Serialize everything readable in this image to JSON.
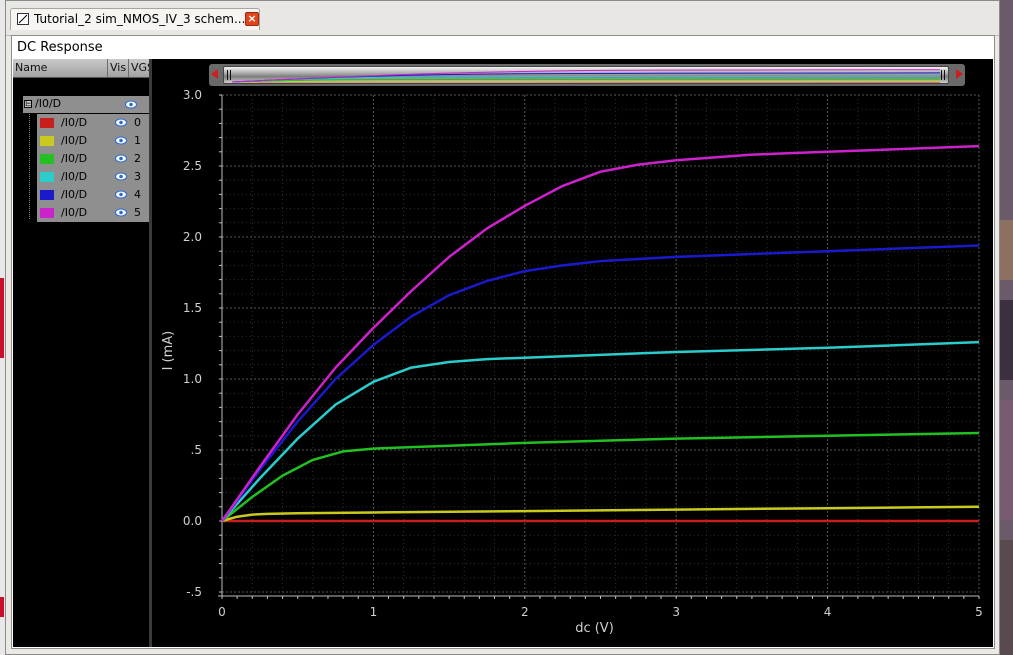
{
  "window": {
    "tab_title": "Tutorial_2 sim_NMOS_IV_3 schem...",
    "tab_close": "×",
    "panel_title": "DC Response"
  },
  "legend": {
    "columns": [
      "Name",
      "Vis",
      "VGS"
    ],
    "root": {
      "label": "/I0/D",
      "toggle": "⊟"
    },
    "rows": [
      {
        "label": "/I0/D",
        "vgs": "0",
        "color": "#c81e1e"
      },
      {
        "label": "/I0/D",
        "vgs": "1",
        "color": "#c9c91e"
      },
      {
        "label": "/I0/D",
        "vgs": "2",
        "color": "#22c022"
      },
      {
        "label": "/I0/D",
        "vgs": "3",
        "color": "#2acccc"
      },
      {
        "label": "/I0/D",
        "vgs": "4",
        "color": "#1a1acc"
      },
      {
        "label": "/I0/D",
        "vgs": "5",
        "color": "#cc22cc"
      }
    ]
  },
  "chart_data": {
    "type": "line",
    "title": "",
    "xlabel": "dc (V)",
    "ylabel": "I (mA)",
    "xlim": [
      0,
      5
    ],
    "ylim": [
      -0.5,
      3.0
    ],
    "x_ticks": [
      "0",
      "1",
      "2",
      "3",
      "4",
      "5"
    ],
    "y_ticks": [
      "-.5",
      "0.0",
      ".5",
      "1.0",
      "1.5",
      "2.0",
      "2.5",
      "3.0"
    ],
    "grid": true,
    "series": [
      {
        "name": "/I0/D",
        "color": "#c81e1e",
        "x": [
          0,
          1,
          2,
          3,
          4,
          5
        ],
        "y": [
          0,
          0,
          0,
          0,
          0,
          0
        ]
      },
      {
        "name": "/I0/D",
        "color": "#c9c91e",
        "x": [
          0,
          0.1,
          0.2,
          0.3,
          0.5,
          1,
          2,
          3,
          4,
          5
        ],
        "y": [
          0,
          0.03,
          0.045,
          0.05,
          0.055,
          0.06,
          0.07,
          0.08,
          0.09,
          0.1
        ]
      },
      {
        "name": "/I0/D",
        "color": "#22c022",
        "x": [
          0,
          0.2,
          0.4,
          0.6,
          0.8,
          1.0,
          1.5,
          2,
          3,
          4,
          5
        ],
        "y": [
          0,
          0.17,
          0.32,
          0.43,
          0.49,
          0.51,
          0.53,
          0.55,
          0.58,
          0.6,
          0.62
        ]
      },
      {
        "name": "/I0/D",
        "color": "#2acccc",
        "x": [
          0,
          0.25,
          0.5,
          0.75,
          1.0,
          1.25,
          1.5,
          1.75,
          2,
          3,
          4,
          5
        ],
        "y": [
          0,
          0.3,
          0.58,
          0.82,
          0.98,
          1.08,
          1.12,
          1.14,
          1.15,
          1.19,
          1.22,
          1.26
        ]
      },
      {
        "name": "/I0/D",
        "color": "#1a1acc",
        "x": [
          0,
          0.25,
          0.5,
          0.75,
          1.0,
          1.25,
          1.5,
          1.75,
          2,
          2.25,
          2.5,
          3,
          4,
          5
        ],
        "y": [
          0,
          0.36,
          0.7,
          1.0,
          1.24,
          1.44,
          1.59,
          1.69,
          1.76,
          1.8,
          1.83,
          1.86,
          1.9,
          1.94
        ]
      },
      {
        "name": "/I0/D",
        "color": "#cc22cc",
        "x": [
          0,
          0.25,
          0.5,
          0.75,
          1.0,
          1.25,
          1.5,
          1.75,
          2,
          2.25,
          2.5,
          2.75,
          3,
          3.5,
          4,
          5
        ],
        "y": [
          0,
          0.38,
          0.75,
          1.08,
          1.36,
          1.62,
          1.86,
          2.06,
          2.22,
          2.36,
          2.46,
          2.51,
          2.54,
          2.58,
          2.6,
          2.64
        ]
      }
    ]
  }
}
